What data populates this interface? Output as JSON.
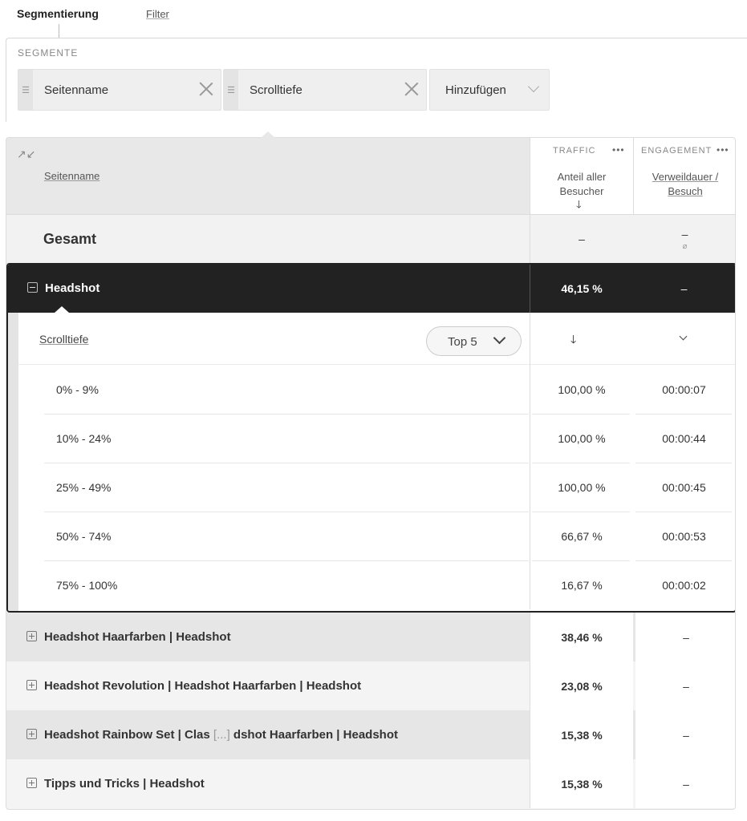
{
  "tabs": {
    "active": "Segmentierung",
    "filter": "Filter"
  },
  "segments": {
    "label": "SEGMENTE",
    "chips": [
      "Seitenname",
      "Scrolltiefe"
    ],
    "add_label": "Hinzufügen"
  },
  "table": {
    "column_name": "Seitenname",
    "groups": {
      "traffic": "TRAFFIC",
      "engagement": "ENGAGEMENT"
    },
    "metric_traffic": "Anteil aller Besucher",
    "metric_engagement": "Verweildauer / Besuch",
    "total": {
      "label": "Gesamt",
      "traffic": "–",
      "engagement": "–",
      "engagement_note": "⌀"
    },
    "expanded": {
      "name": "Headshot",
      "traffic": "46,15 %",
      "engagement": "–",
      "sub_dimension": "Scrolltiefe",
      "top_n": "Top 5",
      "rows": [
        {
          "label": "0% - 9%",
          "traffic": "100,00 %",
          "engagement": "00:00:07"
        },
        {
          "label": "10% - 24%",
          "traffic": "100,00 %",
          "engagement": "00:00:44"
        },
        {
          "label": "25% - 49%",
          "traffic": "100,00 %",
          "engagement": "00:00:45"
        },
        {
          "label": "50% - 74%",
          "traffic": "66,67 %",
          "engagement": "00:00:53"
        },
        {
          "label": "75% - 100%",
          "traffic": "16,67 %",
          "engagement": "00:00:02"
        }
      ]
    },
    "rows": [
      {
        "name": "Headshot Haarfarben | Headshot",
        "traffic": "38,46 %",
        "engagement": "–"
      },
      {
        "name": "Headshot Revolution | Headshot Haarfarben | Headshot",
        "traffic": "23,08 %",
        "engagement": "–"
      },
      {
        "name_start": "Headshot Rainbow Set | Clas",
        "name_ellipsis": "[...]",
        "name_end": "dshot Haarfarben | Headshot",
        "traffic": "15,38 %",
        "engagement": "–"
      },
      {
        "name": "Tipps und Tricks | Headshot",
        "traffic": "15,38 %",
        "engagement": "–"
      }
    ]
  },
  "icons": {
    "collapse": "collapse-arrows-icon",
    "sort": "arrow-down-icon",
    "minus": "minus-square-icon",
    "plus": "plus-square-icon"
  }
}
